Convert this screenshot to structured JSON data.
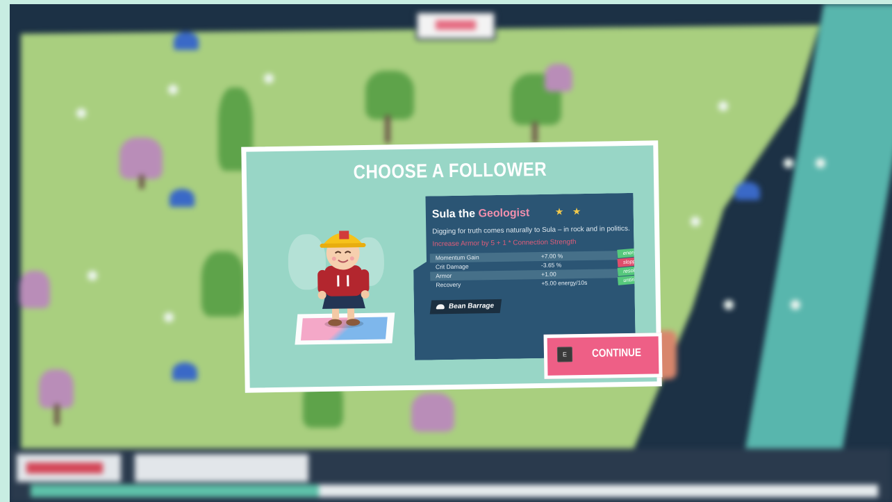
{
  "modal": {
    "title": "CHOOSE A FOLLOWER",
    "follower": {
      "name": "Sula the",
      "job": "Geologist",
      "stars": "★ ★",
      "star_count": 2,
      "description": "Digging for truth comes naturally to Sula – in rock and in politics.",
      "bonus": "Increase Armor by 5 + 1 * Connection Strength",
      "stats": [
        {
          "label": "Momentum Gain",
          "value": "+7.00 %"
        },
        {
          "label": "Crit Damage",
          "value": "-3.65 %"
        },
        {
          "label": "Armor",
          "value": "+1.00"
        },
        {
          "label": "Recovery",
          "value": "+5.00 energy/10s"
        }
      ],
      "traits": [
        {
          "label": "energizing",
          "kind": "positive"
        },
        {
          "label": "sloppy",
          "kind": "negative"
        },
        {
          "label": "resolute",
          "kind": "positive"
        },
        {
          "label": "untiring",
          "kind": "positive"
        }
      ],
      "ability": "Bean Barrage",
      "ability_icon": "bean-icon"
    },
    "continue": {
      "key": "E",
      "label": "CONTINUE"
    }
  },
  "hud": {
    "progress": 0.34
  },
  "colors": {
    "modal_bg": "#98d6c6",
    "panel_bg": "#2b5574",
    "accent_pink": "#ee5f86",
    "trait_positive": "#56c87c",
    "trait_negative": "#de4d6b",
    "star": "#f2c94c"
  }
}
